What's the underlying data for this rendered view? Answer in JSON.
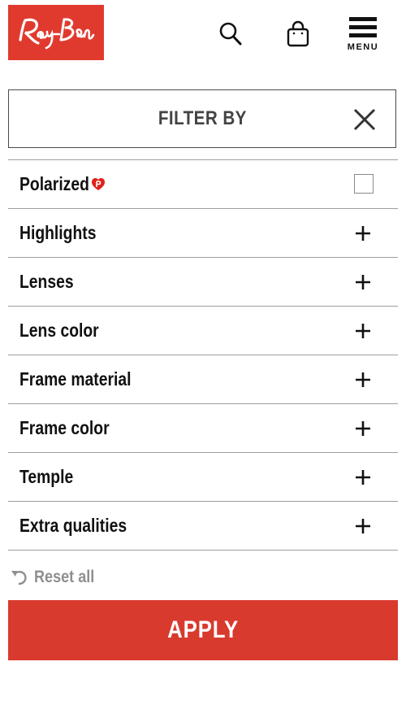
{
  "brand": {
    "logo_text": "Ray-Ban",
    "color": "#e03a2f"
  },
  "header": {
    "icons": [
      "search-icon",
      "shopping-bag-icon",
      "menu-icon"
    ],
    "menu_label": "MENU"
  },
  "filter": {
    "title": "FILTER BY",
    "close_icon": "close-icon"
  },
  "rows": [
    {
      "label": "Polarized",
      "control": "checkbox",
      "checked": false
    },
    {
      "label": "Highlights",
      "control": "expand"
    },
    {
      "label": "Lenses",
      "control": "expand"
    },
    {
      "label": "Lens color",
      "control": "expand"
    },
    {
      "label": "Frame material",
      "control": "expand"
    },
    {
      "label": "Frame color",
      "control": "expand"
    },
    {
      "label": "Temple",
      "control": "expand"
    },
    {
      "label": "Extra qualities",
      "control": "expand"
    }
  ],
  "reset": {
    "label": "Reset all",
    "icon": "undo-icon"
  },
  "apply": {
    "label": "APPLY",
    "color": "#d93a2e"
  }
}
